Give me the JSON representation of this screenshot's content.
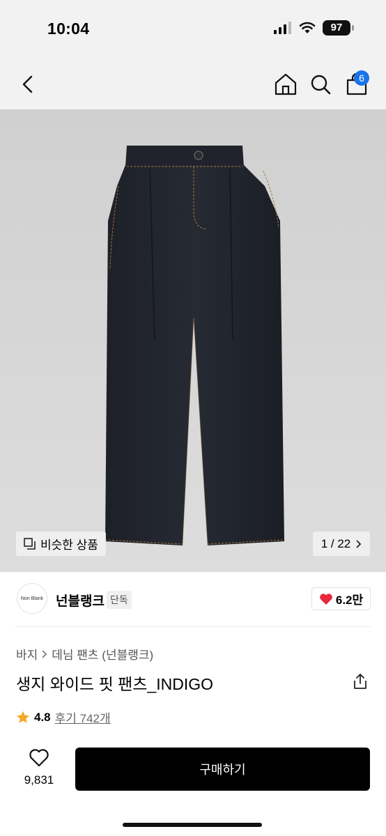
{
  "status_bar": {
    "time": "10:04",
    "battery": "97"
  },
  "nav": {
    "cart_count": "6"
  },
  "gallery": {
    "similar_label": "비슷한 상품",
    "pager": "1 / 22"
  },
  "brand": {
    "logo_text": "Non Blank",
    "name": "넌블랭크",
    "badge": "단독",
    "likes": "6.2만"
  },
  "product": {
    "breadcrumb": [
      "바지",
      "데님 팬츠 (넌블랭크)"
    ],
    "title": "생지 와이드 핏 팬츠_INDIGO",
    "rating": "4.8",
    "reviews": "후기 742개"
  },
  "bottom_bar": {
    "wish_count": "9,831",
    "buy_label": "구매하기"
  },
  "colors": {
    "accent": "#1a73e8",
    "heart": "#e8283c",
    "star": "#f5a623",
    "buy_button": "#000000"
  }
}
